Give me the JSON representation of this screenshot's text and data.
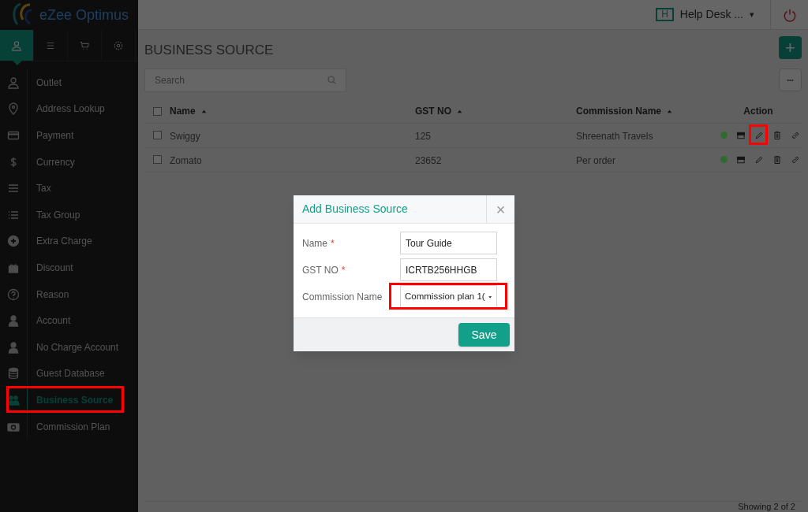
{
  "logo": {
    "text": "eZee Optimus"
  },
  "header": {
    "help_badge": "H",
    "help_label": "Help Desk ...",
    "caret": "▾"
  },
  "sidebar": {
    "tabs": [
      {
        "kind": "user",
        "selected": true
      },
      {
        "kind": "menu",
        "selected": false
      },
      {
        "kind": "cart",
        "selected": false
      },
      {
        "kind": "gear",
        "selected": false
      }
    ],
    "items": [
      {
        "label": "Outlet",
        "kind": "user",
        "selected": false,
        "highlighted": false
      },
      {
        "label": "Address Lookup",
        "kind": "pin",
        "selected": false,
        "highlighted": false
      },
      {
        "label": "Payment",
        "kind": "card",
        "selected": false,
        "highlighted": false
      },
      {
        "label": "Currency",
        "kind": "dollar",
        "selected": false,
        "highlighted": false
      },
      {
        "label": "Tax",
        "kind": "bars",
        "selected": false,
        "highlighted": false
      },
      {
        "label": "Tax Group",
        "kind": "list",
        "selected": false,
        "highlighted": false
      },
      {
        "label": "Extra Charge",
        "kind": "plus",
        "selected": false,
        "highlighted": false
      },
      {
        "label": "Discount",
        "kind": "gift",
        "selected": false,
        "highlighted": false
      },
      {
        "label": "Reason",
        "kind": "question",
        "selected": false,
        "highlighted": false
      },
      {
        "label": "Account",
        "kind": "person",
        "selected": false,
        "highlighted": false
      },
      {
        "label": "No Charge Account",
        "kind": "person",
        "selected": false,
        "highlighted": false
      },
      {
        "label": "Guest Database",
        "kind": "database",
        "selected": false,
        "highlighted": false
      },
      {
        "label": "Business Source",
        "kind": "group",
        "selected": true,
        "highlighted": true
      },
      {
        "label": "Commission Plan",
        "kind": "money",
        "selected": false,
        "highlighted": false
      }
    ]
  },
  "page": {
    "title": "BUSINESS SOURCE",
    "add_button": "+",
    "more_button": "•••",
    "search": {
      "placeholder": "Search"
    }
  },
  "table": {
    "select_all_checked": false,
    "columns": [
      {
        "label": "Name",
        "sorted": true
      },
      {
        "label": "GST NO",
        "sorted": true
      },
      {
        "label": "Commission Name",
        "sorted": true
      },
      {
        "label": "Action",
        "sorted": false
      }
    ],
    "rows": [
      {
        "checked": false,
        "name": "Swiggy",
        "gst_no": "125",
        "commission_name": "Shreenath Travels",
        "color": "#2f6b30",
        "edit_highlighted": true
      },
      {
        "checked": false,
        "name": "Zomato",
        "gst_no": "23652",
        "commission_name": "Per order",
        "color": "#2f6b30",
        "edit_highlighted": false
      }
    ]
  },
  "footer": {
    "text": "Showing 2 of 2"
  },
  "dialog": {
    "title": "Add Business Source",
    "close": "×",
    "fields": [
      {
        "label": "Name",
        "required_mark": "*",
        "kind": "text",
        "value": "Tour Guide",
        "highlighted": false
      },
      {
        "label": "GST NO",
        "required_mark": "*",
        "kind": "text",
        "value": "ICRTB256HHGB",
        "highlighted": false
      },
      {
        "label": "Commission Name",
        "kind": "select",
        "value": "Commission plan 1(",
        "highlighted": true
      }
    ],
    "save_button": "Save"
  }
}
